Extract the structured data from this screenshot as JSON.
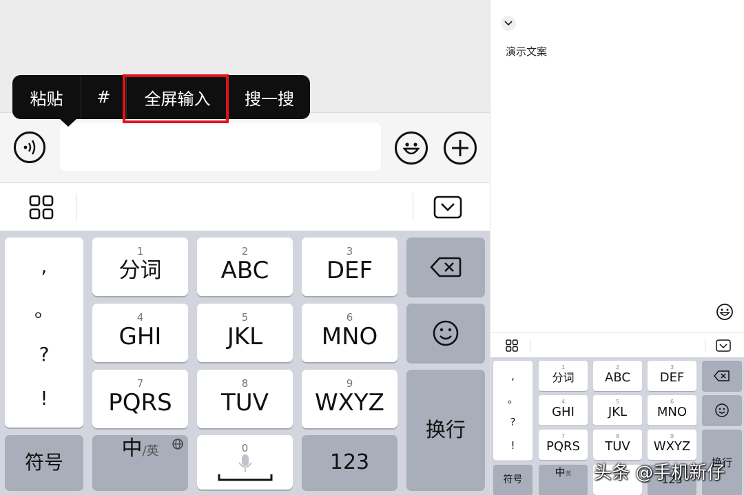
{
  "left_panel": {
    "context_menu": {
      "items": [
        "粘贴",
        "#",
        "全屏输入",
        "搜一搜"
      ],
      "highlighted_item": "全屏输入",
      "highlight_color": "#e0131b"
    },
    "input_bar": {
      "voice_icon": "voice-wave-icon",
      "emoji_icon": "emoji-icon",
      "plus_icon": "plus-icon",
      "text_value": ""
    },
    "toolbar": {
      "grid_icon": "grid-icon",
      "collapse_icon": "collapse-keyboard-icon"
    },
    "keyboard": {
      "punct": [
        ",",
        "。",
        "?",
        "!"
      ],
      "keys": [
        {
          "num": "1",
          "label": "分词"
        },
        {
          "num": "2",
          "label": "ABC"
        },
        {
          "num": "3",
          "label": "DEF"
        },
        {
          "num": "4",
          "label": "GHI"
        },
        {
          "num": "5",
          "label": "JKL"
        },
        {
          "num": "6",
          "label": "MNO"
        },
        {
          "num": "7",
          "label": "PQRS"
        },
        {
          "num": "8",
          "label": "TUV"
        },
        {
          "num": "9",
          "label": "WXYZ"
        }
      ],
      "symbols": "符号",
      "lang_cn": "中",
      "lang_sep": "/",
      "lang_en": "英",
      "space_num": "0",
      "num_key": "123",
      "enter": "换行"
    }
  },
  "right_panel": {
    "note_text": "演示文案",
    "keyboard": {
      "punct": [
        ",",
        "。",
        "?",
        "!"
      ],
      "keys": [
        {
          "num": "1",
          "label": "分词"
        },
        {
          "num": "2",
          "label": "ABC"
        },
        {
          "num": "3",
          "label": "DEF"
        },
        {
          "num": "4",
          "label": "GHI"
        },
        {
          "num": "5",
          "label": "JKL"
        },
        {
          "num": "6",
          "label": "MNO"
        },
        {
          "num": "7",
          "label": "PQRS"
        },
        {
          "num": "8",
          "label": "TUV"
        },
        {
          "num": "9",
          "label": "WXYZ"
        }
      ],
      "symbols": "符号",
      "lang_cn": "中",
      "lang_en": "英",
      "num_key": "123",
      "enter": "换行"
    }
  },
  "watermark": "头条 @手机新仔"
}
